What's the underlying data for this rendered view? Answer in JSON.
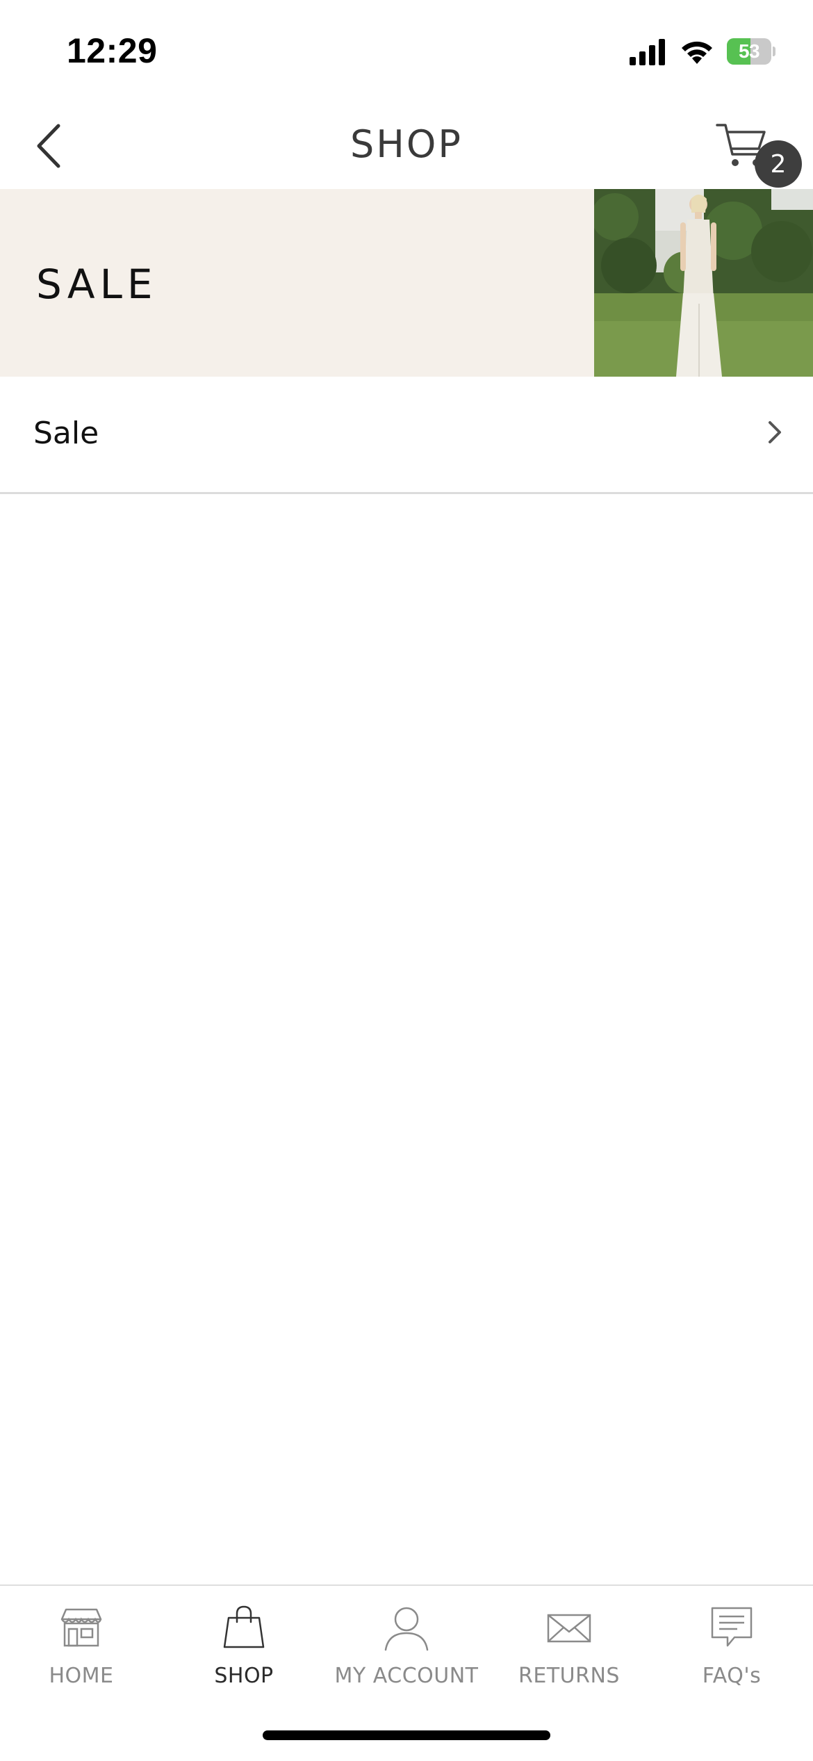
{
  "status_bar": {
    "time": "12:29",
    "battery_percent": "53",
    "battery_level": 0.53,
    "battery_color": "#57c152",
    "icons": [
      "signal-icon",
      "wifi-icon",
      "battery-icon"
    ]
  },
  "header": {
    "title": "SHOP",
    "back_icon": "chevron-left-icon",
    "cart_icon": "cart-icon",
    "cart_count": "2"
  },
  "banner": {
    "title": "SALE",
    "background_color": "#f5f0ea",
    "image": "photo of model in white knit dress on lawn"
  },
  "list": {
    "items": [
      {
        "label": "Sale",
        "icon": "chevron-right-icon"
      }
    ]
  },
  "tab_bar": {
    "active": "SHOP",
    "tabs": [
      {
        "label": "HOME",
        "icon": "storefront-icon"
      },
      {
        "label": "SHOP",
        "icon": "shopping-bag-icon"
      },
      {
        "label": "MY ACCOUNT",
        "icon": "user-icon"
      },
      {
        "label": "RETURNS",
        "icon": "envelope-icon"
      },
      {
        "label": "FAQ's",
        "icon": "chat-bubble-icon"
      }
    ]
  }
}
